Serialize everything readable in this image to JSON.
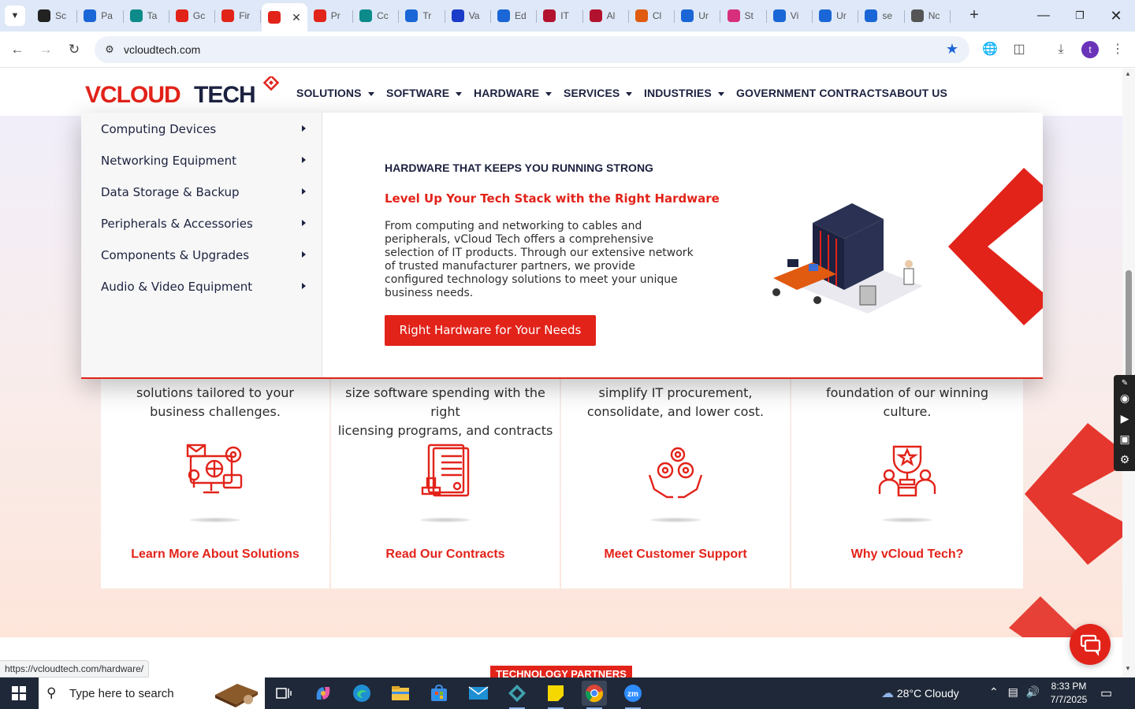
{
  "browser": {
    "tabs": [
      {
        "label": "Sc",
        "color": "#222"
      },
      {
        "label": "Pa",
        "color": "#1a66d6"
      },
      {
        "label": "Ta",
        "color": "#0d8a8a"
      },
      {
        "label": "Gc",
        "color": "#e2231a"
      },
      {
        "label": "Fir",
        "color": "#e2231a"
      },
      {
        "label": "",
        "color": "#e2231a"
      },
      {
        "label": "Pr",
        "color": "#e2231a"
      },
      {
        "label": "Cc",
        "color": "#0d8a8a"
      },
      {
        "label": "Tr",
        "color": "#1a66d6"
      },
      {
        "label": "Va",
        "color": "#1a3cc8"
      },
      {
        "label": "Ed",
        "color": "#1a66d6"
      },
      {
        "label": "IT",
        "color": "#b3122e"
      },
      {
        "label": "Al",
        "color": "#b3122e"
      },
      {
        "label": "Cl",
        "color": "#e05a10"
      },
      {
        "label": "Ur",
        "color": "#1a66d6"
      },
      {
        "label": "St",
        "color": "#d72f7c"
      },
      {
        "label": "Vi",
        "color": "#1a66d6"
      },
      {
        "label": "Ur",
        "color": "#1a66d6"
      },
      {
        "label": "se",
        "color": "#1a66d6"
      },
      {
        "label": "Nc",
        "color": "#555"
      }
    ],
    "active_tab_index": 5,
    "url": "vcloudtech.com",
    "profile_initial": "t",
    "status_link": "https://vcloudtech.com/hardware/"
  },
  "site": {
    "logo_text": "VCLOUD TECH",
    "menu": [
      {
        "label": "SOLUTIONS",
        "has_caret": true
      },
      {
        "label": "SOFTWARE",
        "has_caret": true
      },
      {
        "label": "HARDWARE",
        "has_caret": true
      },
      {
        "label": "SERVICES",
        "has_caret": true
      },
      {
        "label": "INDUSTRIES",
        "has_caret": true
      },
      {
        "label": "GOVERNMENT CONTRACTS",
        "has_caret": false
      },
      {
        "label": "ABOUT US",
        "has_caret": false
      }
    ],
    "mega_menu": {
      "items": [
        "Computing Devices",
        "Networking Equipment",
        "Data Storage & Backup",
        "Peripherals & Accessories",
        "Components & Upgrades",
        "Audio & Video Equipment"
      ],
      "headline": "HARDWARE THAT KEEPS YOU RUNNING STRONG",
      "subheadline": "Level Up Your Tech Stack with the Right Hardware",
      "body": "From computing and networking to cables and peripherals, vCloud Tech offers a comprehensive selection of IT products. Through our extensive network of trusted manufacturer partners, we provide configured technology solutions to meet your unique business needs.",
      "button": "Right Hardware for Your Needs"
    },
    "cards": [
      {
        "desc_line1": "solutions tailored to your",
        "desc_line2": "business challenges.",
        "cta": "Learn More About Solutions",
        "icon": "solutions-icon"
      },
      {
        "desc_line1": "size software spending with the right",
        "desc_line2": "licensing programs, and contracts",
        "cta": "Read Our Contracts",
        "icon": "contract-icon"
      },
      {
        "desc_line1": "simplify IT procurement,",
        "desc_line2": "consolidate, and lower cost.",
        "cta": "Meet Customer Support",
        "icon": "support-gears-icon"
      },
      {
        "desc_line1": "foundation of our winning",
        "desc_line2": "culture.",
        "cta": "Why vCloud Tech?",
        "icon": "award-team-icon"
      }
    ],
    "partners_label": "TECHNOLOGY PARTNERS",
    "accent": "#e2231a",
    "navy": "#1c2240"
  },
  "taskbar": {
    "search_placeholder": "Type here to search",
    "weather": "28°C  Cloudy",
    "time": "8:33 PM",
    "date": "7/7/2025"
  }
}
